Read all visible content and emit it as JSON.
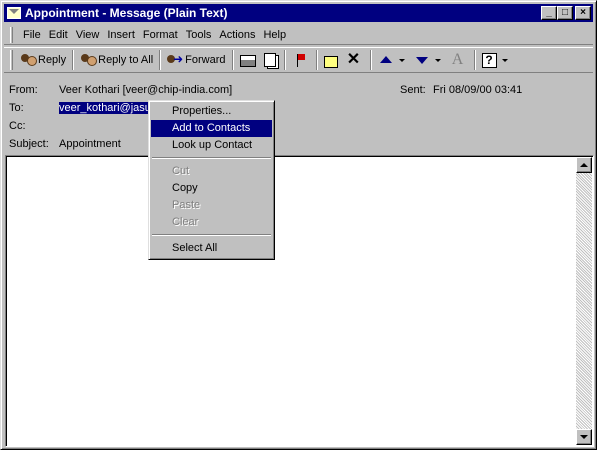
{
  "window": {
    "title": "Appointment - Message (Plain Text)",
    "minimize": "_",
    "maximize": "□",
    "close": "×"
  },
  "menubar": [
    "File",
    "Edit",
    "View",
    "Insert",
    "Format",
    "Tools",
    "Actions",
    "Help"
  ],
  "toolbar": {
    "reply": "Reply",
    "reply_all": "Reply to All",
    "forward": "Forward",
    "delete_glyph": "✕",
    "font_glyph": "A",
    "help_glyph": "?"
  },
  "header": {
    "from_label": "From:",
    "from_value": "Veer Kothari [veer@chip-india.com]",
    "to_label": "To:",
    "to_value": "veer_kothari@jasu",
    "cc_label": "Cc:",
    "cc_value": "",
    "subject_label": "Subject:",
    "subject_value": "Appointment",
    "sent_label": "Sent:",
    "sent_value": "Fri 08/09/00 03:41"
  },
  "context_menu": {
    "items": [
      {
        "label": "Properties...",
        "state": "normal"
      },
      {
        "label": "Add to Contacts",
        "state": "highlighted"
      },
      {
        "label": "Look up Contact",
        "state": "normal"
      },
      {
        "label": "Cut",
        "state": "disabled"
      },
      {
        "label": "Copy",
        "state": "normal"
      },
      {
        "label": "Paste",
        "state": "disabled"
      },
      {
        "label": "Clear",
        "state": "disabled"
      },
      {
        "label": "Select All",
        "state": "normal"
      }
    ]
  },
  "colors": {
    "title_bar": "#000080",
    "face": "#c0c0c0",
    "highlight": "#000080"
  }
}
